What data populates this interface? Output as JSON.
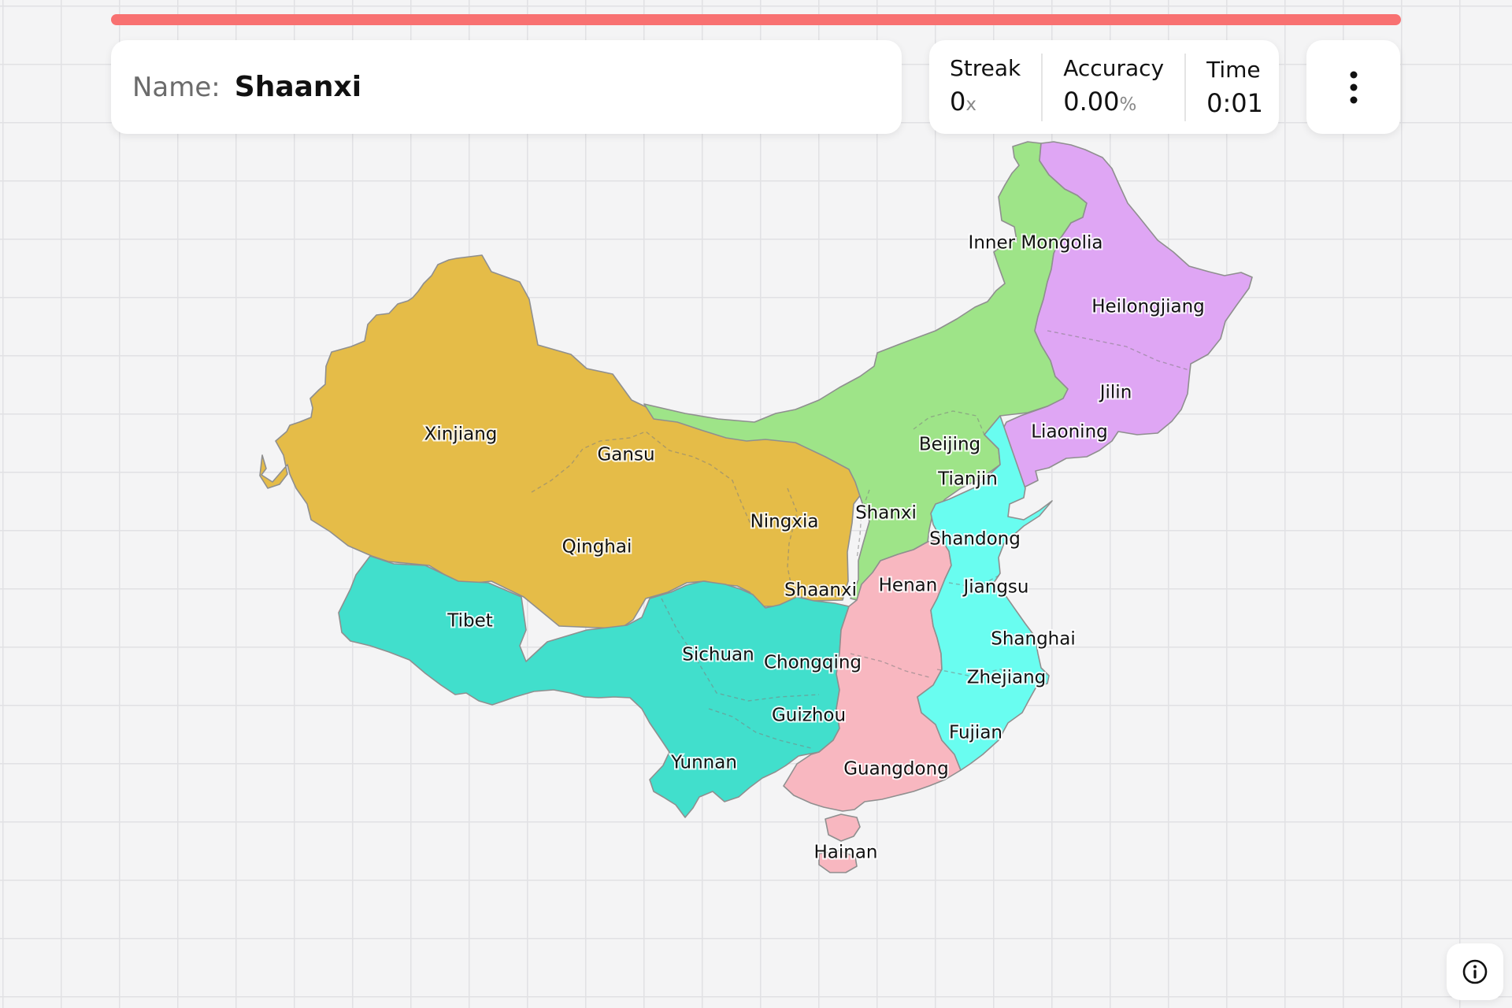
{
  "game": {
    "progress_fraction": 1.0,
    "name_label": "Name:",
    "target_name": "Shaanxi"
  },
  "stats": {
    "streak_label": "Streak",
    "streak_value": "0",
    "streak_unit": "x",
    "accuracy_label": "Accuracy",
    "accuracy_value": "0.00",
    "accuracy_unit": "%",
    "time_label": "Time",
    "time_value": "0:01"
  },
  "icons": {
    "menu": "more-vertical-icon",
    "info": "info-icon"
  },
  "colors": {
    "northwest": "#e5bc48",
    "north": "#9ee488",
    "northeast": "#dfa6f4",
    "southwest": "#41dfcc",
    "south_central": "#f8b7c0",
    "east": "#69fdf0",
    "progress_track": "#fde4e4"
  },
  "map": {
    "labels": {
      "xinjiang": "Xinjiang",
      "gansu": "Gansu",
      "qinghai": "Qinghai",
      "tibet": "Tibet",
      "inner_mongolia": "Inner Mongolia",
      "heilongjiang": "Heilongjiang",
      "jilin": "Jilin",
      "liaoning": "Liaoning",
      "beijing": "Beijing",
      "tianjin": "Tianjin",
      "ningxia": "Ningxia",
      "shanxi": "Shanxi",
      "shandong": "Shandong",
      "shaanxi": "Shaanxi",
      "henan": "Henan",
      "jiangsu": "Jiangsu",
      "shanghai": "Shanghai",
      "sichuan": "Sichuan",
      "chongqing": "Chongqing",
      "zhejiang": "Zhejiang",
      "guizhou": "Guizhou",
      "fujian": "Fujian",
      "yunnan": "Yunnan",
      "guangdong": "Guangdong",
      "hainan": "Hainan"
    }
  }
}
